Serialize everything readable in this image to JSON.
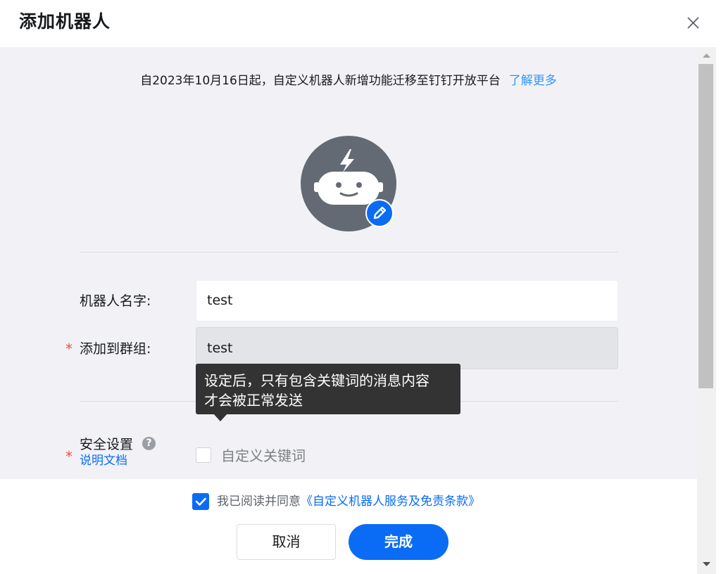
{
  "dialog": {
    "title": "添加机器人"
  },
  "notice": {
    "text": "自2023年10月16日起，自定义机器人新增功能迁移至钉钉开放平台",
    "link": "了解更多"
  },
  "form": {
    "name_label": "机器人名字:",
    "name_value": "test",
    "group_label": "添加到群组:",
    "group_value": "test",
    "required_mark": "*",
    "security_label": "安全设置",
    "help_glyph": "?",
    "doc_link": "说明文档",
    "keyword_option": "自定义关键词"
  },
  "tooltip": {
    "line1": "设定后，只有包含关键词的消息内容",
    "line2": "才会被正常发送"
  },
  "footer": {
    "agree_text": "我已阅读并同意",
    "agree_link": "《自定义机器人服务及免责条款》",
    "agree_checked": true,
    "cancel_label": "取消",
    "done_label": "完成"
  },
  "colors": {
    "primary": "#0a6cf5",
    "link": "#3296fa",
    "required": "#f54a45",
    "avatar_bg": "#646a73",
    "body_bg": "#f2f2f6",
    "tooltip_bg": "#333333"
  },
  "icons": {
    "close": "close-icon",
    "avatar": "robot-icon",
    "edit": "pencil-icon",
    "help": "question-mark-icon",
    "checkbox": "checkmark-icon",
    "scroll_up": "triangle-up-icon",
    "scroll_down": "triangle-down-icon"
  }
}
